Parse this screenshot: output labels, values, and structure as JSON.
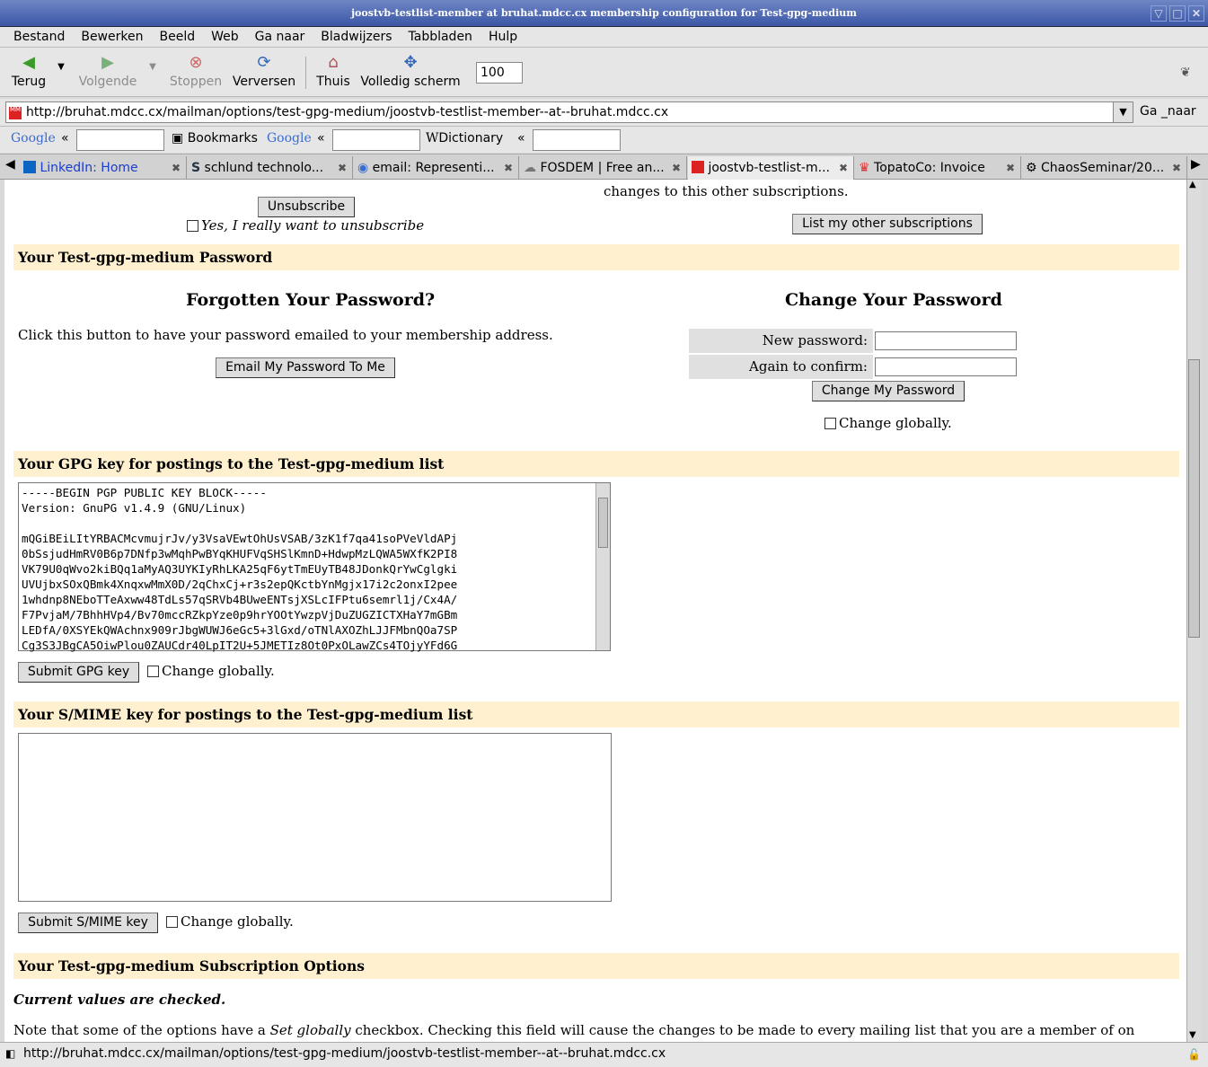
{
  "window": {
    "title": "joostvb-testlist-member at bruhat.mdcc.cx membership configuration for Test-gpg-medium"
  },
  "menu": [
    "Bestand",
    "Bewerken",
    "Beeld",
    "Web",
    "Ga naar",
    "Bladwijzers",
    "Tabbladen",
    "Hulp"
  ],
  "toolbar": {
    "back": "Terug",
    "forward": "Volgende",
    "stop": "Stoppen",
    "reload": "Verversen",
    "home": "Thuis",
    "fullscreen": "Volledig scherm",
    "zoom": "100"
  },
  "url": {
    "value": "http://bruhat.mdcc.cx/mailman/options/test-gpg-medium/joostvb-testlist-member--at--bruhat.mdcc.cx",
    "go": "Ga _naar"
  },
  "searchbar": {
    "google1": "Google",
    "bookmarks": "Bookmarks",
    "google2": "Google",
    "dictionary": "Dictionary"
  },
  "tabs": [
    "LinkedIn: Home",
    "schlund technolo...",
    "email: Representi...",
    "FOSDEM | Free an...",
    "joostvb-testlist-m...",
    "TopatoCo: Invoice",
    "ChaosSeminar/20..."
  ],
  "page": {
    "unsubscribe_button": "Unsubscribe",
    "unsubscribe_confirm": "Yes, I really want to unsubscribe",
    "other_subs_text": "changes to this other subscriptions.",
    "list_other_button": "List my other subscriptions",
    "password_section": "Your Test-gpg-medium Password",
    "forgotten_title": "Forgotten Your Password?",
    "forgotten_text": "Click this button to have your password emailed to your membership address.",
    "email_pw_button": "Email My Password To Me",
    "change_title": "Change Your Password",
    "new_pw_label": "New password:",
    "confirm_pw_label": "Again to confirm:",
    "change_pw_button": "Change My Password",
    "change_globally": "Change globally.",
    "gpg_section": "Your GPG key for postings to the Test-gpg-medium list",
    "gpg_key": "-----BEGIN PGP PUBLIC KEY BLOCK-----\nVersion: GnuPG v1.4.9 (GNU/Linux)\n\nmQGiBEiLItYRBACMcvmujrJv/y3VsaVEwtOhUsVSAB/3zK1f7qa41soPVeVldAPj\n0bSsjudHmRV0B6p7DNfp3wMqhPwBYqKHUFVqSHSlKmnD+HdwpMzLQWA5WXfK2PI8\nVK79U0qWvo2kiBQq1aMyAQ3UYKIyRhLKA25qF6ytTmEUyTB48JDonkQrYwCglgki\nUVUjbxSOxQBmk4XnqxwMmX0D/2qChxCj+r3s2epQKctbYnMgjx17i2c2onxI2pee\n1whdnp8NEboTTeAxww48TdLs57qSRVb4BUweENTsjXSLcIFPtu6semrl1j/Cx4A/\nF7PvjaM/7BhhHVp4/Bv70mccRZkpYze0p9hrYOOtYwzpVjDuZUGZICTXHaY7mGBm\nLEDfA/0XSYEkQWAchnx909rJbgWUWJ6eGc5+3lGxd/oTNlAXOZhLJJFMbnQOa7SP\nCg3S3JBgCA5OiwPlou0ZAUCdr40LpIT2U+5JMETIz8Ot0PxOLawZCs4TOjyYFd6G",
    "submit_gpg_button": "Submit GPG key",
    "smime_section": "Your S/MIME key for postings to the Test-gpg-medium list",
    "submit_smime_button": "Submit S/MIME key",
    "subscription_section": "Your Test-gpg-medium Subscription Options",
    "current_values": "Current values are checked.",
    "note_prefix": "Note that some of the options have a ",
    "note_em": "Set globally",
    "note_suffix": " checkbox. Checking this field will cause the changes to be made to every mailing list that you are a member of on"
  },
  "status": {
    "text": "http://bruhat.mdcc.cx/mailman/options/test-gpg-medium/joostvb-testlist-member--at--bruhat.mdcc.cx"
  },
  "colors": {
    "section_bg": "#fff0d0",
    "titlebar": "#3b57a6"
  }
}
